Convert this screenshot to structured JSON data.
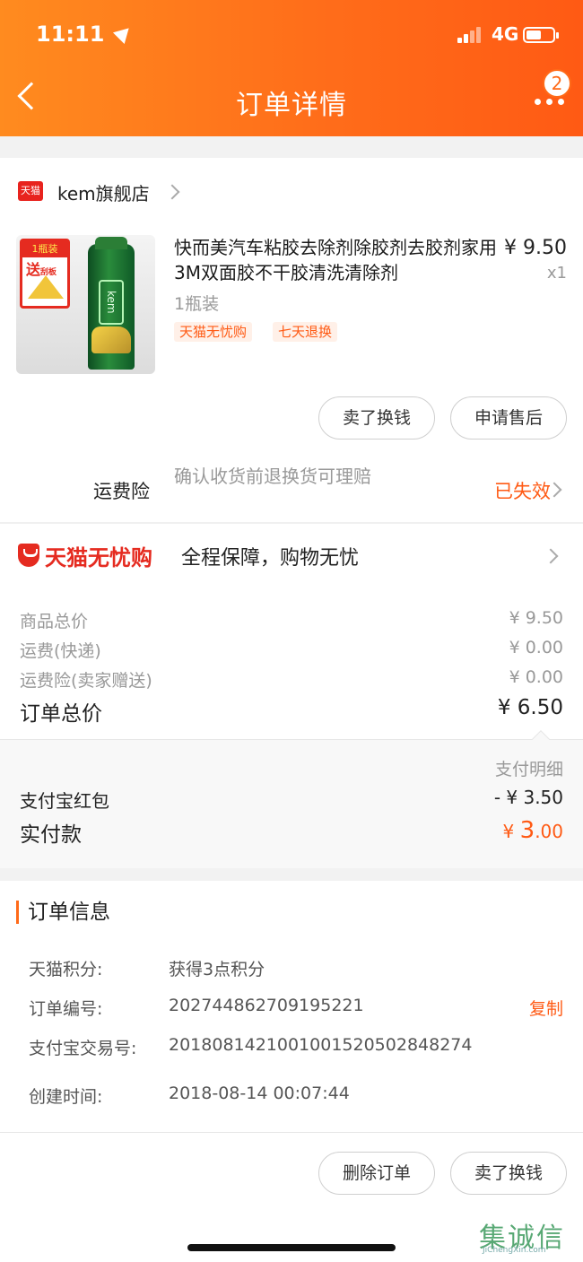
{
  "status_bar": {
    "time": "11:11",
    "network": "4G"
  },
  "nav": {
    "title": "订单详情",
    "badge_count": "2"
  },
  "store": {
    "logo_text": "天猫",
    "name": "kem旗舰店",
    "product": {
      "title": "快而美汽车粘胶去除剂除胶剂去胶剂家用3M双面胶不干胶清洗清除剂",
      "price": "¥ 9.50",
      "quantity": "x1",
      "spec": "1瓶装",
      "image_badge_line1": "1瓶装",
      "image_badge_line2": "送",
      "image_badge_line3": "刮板",
      "image_can_label": "kem",
      "tags": [
        "天猫无忧购",
        "七天退换"
      ]
    },
    "buttons": {
      "sell_exchange": "卖了换钱",
      "after_sale": "申请售后"
    },
    "freight_insurance": {
      "label": "运费险",
      "description": "确认收货前退换货可理赔",
      "status": "已失效"
    }
  },
  "worry_free": {
    "brand": "天猫无忧购",
    "text": "全程保障，购物无忧"
  },
  "summary": {
    "rows": [
      {
        "label": "商品总价",
        "value": "¥ 9.50"
      },
      {
        "label": "运费(快递)",
        "value": "¥ 0.00"
      },
      {
        "label": "运费险(卖家赠送)",
        "value": "¥ 0.00"
      }
    ],
    "total_label": "订单总价",
    "total_value": "¥ 6.50"
  },
  "payment": {
    "detail_link": "支付明细",
    "red_packet_label": "支付宝红包",
    "red_packet_value": "- ¥ 3.50",
    "paid_label": "实付款",
    "paid_currency": "¥ ",
    "paid_integer": "3",
    "paid_decimal": ".00"
  },
  "order_info": {
    "title": "订单信息",
    "rows": [
      {
        "label": "天猫积分:",
        "value": "获得3点积分"
      },
      {
        "label": "订单编号:",
        "value": "202744862709195221"
      },
      {
        "label": "支付宝交易号:",
        "value": "2018081421001001520502848274"
      },
      {
        "label": "创建时间:",
        "value": "2018-08-14 00:07:44"
      }
    ],
    "copy_label": "复制"
  },
  "bottom": {
    "delete_order": "删除订单",
    "sell_exchange": "卖了换钱",
    "watermark_text": "集诚信",
    "watermark_url": "JiChengXin.com"
  },
  "colors": {
    "accent": "#ff5a14",
    "tmall_red": "#e52b20",
    "header_start": "#ff8b1f",
    "header_end": "#ff5a14"
  }
}
